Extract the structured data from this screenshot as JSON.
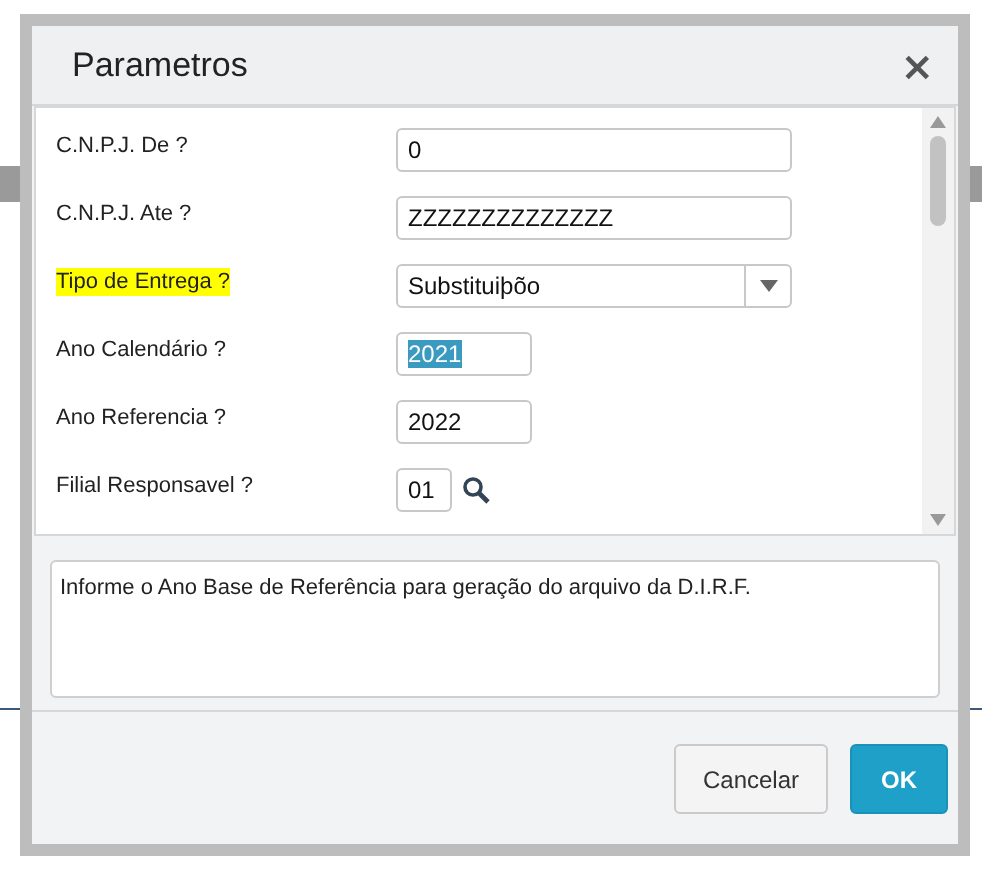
{
  "dialog": {
    "title": "Parametros",
    "close": "×"
  },
  "parameters": [
    {
      "kind": "text",
      "label": "C.N.P.J. De ?",
      "value": "0",
      "highlighted": false,
      "text_selected": false
    },
    {
      "kind": "text",
      "label": "C.N.P.J. Ate ?",
      "value": "ZZZZZZZZZZZZZZ",
      "highlighted": false,
      "text_selected": false
    },
    {
      "kind": "select",
      "label": "Tipo de Entrega ?",
      "value": "Substituiþõo",
      "highlighted": true,
      "text_selected": false
    },
    {
      "kind": "short",
      "label": "Ano Calendário ?",
      "value": "2021",
      "highlighted": false,
      "text_selected": true
    },
    {
      "kind": "short",
      "label": "Ano Referencia ?",
      "value": "2022",
      "highlighted": false,
      "text_selected": false
    },
    {
      "kind": "lookup",
      "label": "Filial Responsavel ?",
      "value": "01",
      "highlighted": false,
      "text_selected": false
    }
  ],
  "help": "Informe o Ano Base de Referência para geração do arquivo da D.I.R.F.",
  "buttons": [
    {
      "kind": "secondary",
      "label": "Cancelar"
    },
    {
      "kind": "primary",
      "label": "OK"
    }
  ]
}
